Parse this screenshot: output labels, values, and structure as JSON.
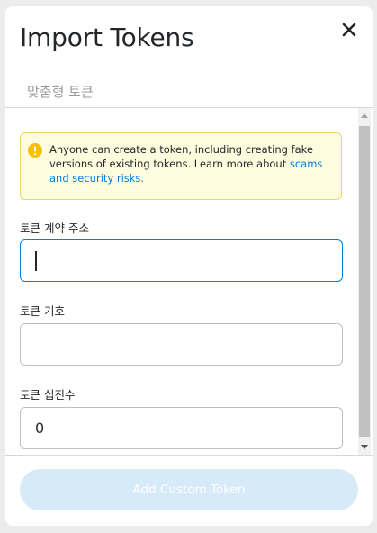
{
  "modal": {
    "title": "Import Tokens",
    "tab_custom_token": "맞춤형 토큰"
  },
  "warning": {
    "text": "Anyone can create a token, including creating fake versions of existing tokens. Learn more about ",
    "link": "scams and security risks",
    "trailing": "."
  },
  "fields": {
    "contract_address_label": "토큰 계약 주소",
    "contract_address_value": "",
    "symbol_label": "토큰 기호",
    "symbol_value": "",
    "decimals_label": "토큰 십진수",
    "decimals_value": "0"
  },
  "footer": {
    "add_button_label": "Add Custom Token"
  },
  "colors": {
    "accent": "#037dd6",
    "warning_bg": "#fefcde",
    "warning_border": "#f0d464",
    "warning_icon": "#f8c000",
    "disabled_button": "#d6eaf8"
  },
  "icons": {
    "close": "close-icon",
    "warning": "info-warning-icon"
  }
}
